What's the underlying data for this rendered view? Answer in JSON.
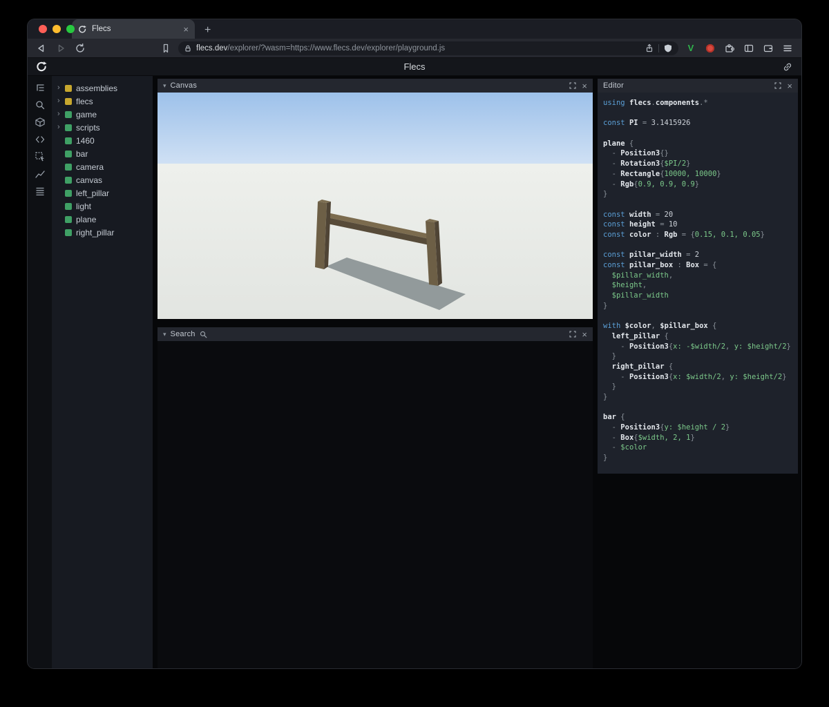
{
  "browser": {
    "tab_title": "Flecs",
    "url_domain": "flecs.dev",
    "url_rest": "/explorer/?wasm=https://www.flecs.dev/explorer/playground.js",
    "extension_v_label": "V",
    "icons": [
      "back-icon",
      "forward-icon",
      "reload-icon",
      "bookmark-icon",
      "lock-icon",
      "share-icon",
      "shield-icon",
      "extension-v-icon",
      "extension-red-icon",
      "extensions-puzzle-icon",
      "sidebar-toggle-icon",
      "wallet-icon",
      "menu-icon"
    ]
  },
  "app": {
    "header_title": "Flecs"
  },
  "glyphs": {
    "close": "×",
    "plus": "+",
    "expand_arrow": "›",
    "caret": "▾"
  },
  "panels": {
    "canvas_title": "Canvas",
    "search_title": "Search",
    "editor_title": "Editor"
  },
  "sidebar_icons": [
    "hierarchy-icon",
    "search-icon",
    "package-icon",
    "code-icon",
    "inspect-icon",
    "stats-icon",
    "queries-icon"
  ],
  "tree": {
    "items": [
      {
        "label": "assemblies",
        "expandable": true,
        "color": "#c7a72e"
      },
      {
        "label": "flecs",
        "expandable": true,
        "color": "#c7a72e"
      },
      {
        "label": "game",
        "expandable": true,
        "color": "#3fa065"
      },
      {
        "label": "scripts",
        "expandable": true,
        "color": "#3fa065"
      },
      {
        "label": "1460",
        "expandable": false,
        "color": "#3fa065"
      },
      {
        "label": "bar",
        "expandable": false,
        "color": "#3fa065"
      },
      {
        "label": "camera",
        "expandable": false,
        "color": "#3fa065"
      },
      {
        "label": "canvas",
        "expandable": false,
        "color": "#3fa065"
      },
      {
        "label": "left_pillar",
        "expandable": false,
        "color": "#3fa065"
      },
      {
        "label": "light",
        "expandable": false,
        "color": "#3fa065"
      },
      {
        "label": "plane",
        "expandable": false,
        "color": "#3fa065"
      },
      {
        "label": "right_pillar",
        "expandable": false,
        "color": "#3fa065"
      }
    ]
  },
  "scene": {
    "sky_top": "#9dc1ea",
    "sky_bottom": "#cfe0f4",
    "ground_far": "#eef0ec",
    "ground": "#e2e5e1",
    "wood_light": "#7d6e52",
    "wood_mid": "#6d5f46",
    "wood_dark": "#4f4435",
    "bar_top": "#7b6b4e",
    "bar_front": "#574b39",
    "shadow": "#929a9b"
  },
  "code": {
    "lines": [
      [
        [
          "kw",
          "using "
        ],
        [
          "id",
          "flecs"
        ],
        [
          "pun",
          "."
        ],
        [
          "id",
          "components"
        ],
        [
          "pun",
          ".*"
        ]
      ],
      [],
      [
        [
          "kw",
          "const "
        ],
        [
          "id",
          "PI"
        ],
        [
          "pun",
          " = "
        ],
        [
          "pln",
          "3.1415926"
        ]
      ],
      [],
      [
        [
          "id",
          "plane"
        ],
        [
          "pun",
          " {"
        ]
      ],
      [
        [
          "pun",
          "  - "
        ],
        [
          "id",
          "Position3"
        ],
        [
          "pun",
          "{}"
        ]
      ],
      [
        [
          "pun",
          "  - "
        ],
        [
          "id",
          "Rotation3"
        ],
        [
          "pun",
          "{"
        ],
        [
          "val",
          "$PI/2"
        ],
        [
          "pun",
          "}"
        ]
      ],
      [
        [
          "pun",
          "  - "
        ],
        [
          "id",
          "Rectangle"
        ],
        [
          "pun",
          "{"
        ],
        [
          "val",
          "10000, 10000"
        ],
        [
          "pun",
          "}"
        ]
      ],
      [
        [
          "pun",
          "  - "
        ],
        [
          "id",
          "Rgb"
        ],
        [
          "pun",
          "{"
        ],
        [
          "val",
          "0.9, 0.9, 0.9"
        ],
        [
          "pun",
          "}"
        ]
      ],
      [
        [
          "pun",
          "}"
        ]
      ],
      [],
      [
        [
          "kw",
          "const "
        ],
        [
          "id",
          "width"
        ],
        [
          "pun",
          " = "
        ],
        [
          "pln",
          "20"
        ]
      ],
      [
        [
          "kw",
          "const "
        ],
        [
          "id",
          "height"
        ],
        [
          "pun",
          " = "
        ],
        [
          "pln",
          "10"
        ]
      ],
      [
        [
          "kw",
          "const "
        ],
        [
          "id",
          "color"
        ],
        [
          "pun",
          " : "
        ],
        [
          "id",
          "Rgb"
        ],
        [
          "pun",
          " = {"
        ],
        [
          "val",
          "0.15, 0.1, 0.05"
        ],
        [
          "pun",
          "}"
        ]
      ],
      [],
      [
        [
          "kw",
          "const "
        ],
        [
          "id",
          "pillar_width"
        ],
        [
          "pun",
          " = "
        ],
        [
          "pln",
          "2"
        ]
      ],
      [
        [
          "kw",
          "const "
        ],
        [
          "id",
          "pillar_box"
        ],
        [
          "pun",
          " : "
        ],
        [
          "id",
          "Box"
        ],
        [
          "pun",
          " = {"
        ]
      ],
      [
        [
          "pun",
          "  "
        ],
        [
          "val",
          "$pillar_width"
        ],
        [
          "pun",
          ","
        ]
      ],
      [
        [
          "pun",
          "  "
        ],
        [
          "val",
          "$height"
        ],
        [
          "pun",
          ","
        ]
      ],
      [
        [
          "pun",
          "  "
        ],
        [
          "val",
          "$pillar_width"
        ]
      ],
      [
        [
          "pun",
          "}"
        ]
      ],
      [],
      [
        [
          "kw",
          "with "
        ],
        [
          "id",
          "$color"
        ],
        [
          "pun",
          ", "
        ],
        [
          "id",
          "$pillar_box"
        ],
        [
          "pun",
          " {"
        ]
      ],
      [
        [
          "pun",
          "  "
        ],
        [
          "id",
          "left_pillar"
        ],
        [
          "pun",
          " {"
        ]
      ],
      [
        [
          "pun",
          "    - "
        ],
        [
          "id",
          "Position3"
        ],
        [
          "pun",
          "{"
        ],
        [
          "val",
          "x: -$width/2"
        ],
        [
          "pun",
          ", "
        ],
        [
          "val",
          "y: $height/2"
        ],
        [
          "pun",
          "}"
        ]
      ],
      [
        [
          "pun",
          "  }"
        ]
      ],
      [
        [
          "pun",
          "  "
        ],
        [
          "id",
          "right_pillar"
        ],
        [
          "pun",
          " {"
        ]
      ],
      [
        [
          "pun",
          "    - "
        ],
        [
          "id",
          "Position3"
        ],
        [
          "pun",
          "{"
        ],
        [
          "val",
          "x: $width/2"
        ],
        [
          "pun",
          ", "
        ],
        [
          "val",
          "y: $height/2"
        ],
        [
          "pun",
          "}"
        ]
      ],
      [
        [
          "pun",
          "  }"
        ]
      ],
      [
        [
          "pun",
          "}"
        ]
      ],
      [],
      [
        [
          "id",
          "bar"
        ],
        [
          "pun",
          " {"
        ]
      ],
      [
        [
          "pun",
          "  - "
        ],
        [
          "id",
          "Position3"
        ],
        [
          "pun",
          "{"
        ],
        [
          "val",
          "y: $height / 2"
        ],
        [
          "pun",
          "}"
        ]
      ],
      [
        [
          "pun",
          "  - "
        ],
        [
          "id",
          "Box"
        ],
        [
          "pun",
          "{"
        ],
        [
          "val",
          "$width, 2, 1"
        ],
        [
          "pun",
          "}"
        ]
      ],
      [
        [
          "pun",
          "  - "
        ],
        [
          "val",
          "$color"
        ]
      ],
      [
        [
          "pun",
          "}"
        ]
      ]
    ]
  }
}
